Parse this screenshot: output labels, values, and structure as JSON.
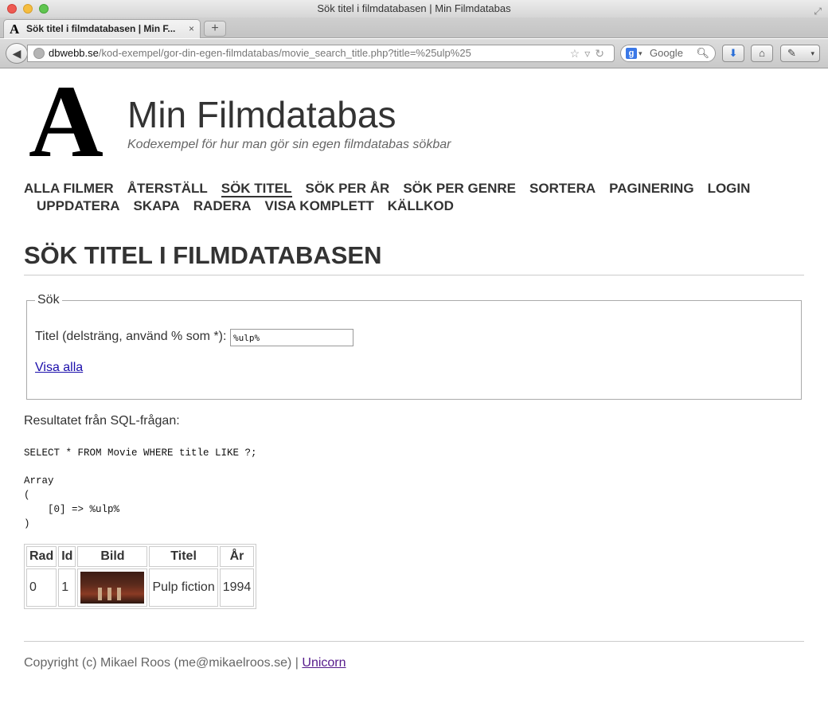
{
  "window": {
    "title": "Sök titel i filmdatabasen | Min Filmdatabas"
  },
  "tab": {
    "label": "Sök titel i filmdatabasen | Min F...",
    "favicon": "A",
    "new_tab": "+"
  },
  "address_bar": {
    "domain": "dbwebb.se",
    "path": "/kod-exempel/gor-din-egen-filmdatabas/movie_search_title.php?title=%25ulp%25",
    "search_engine": "Google"
  },
  "site": {
    "logo_letter": "A",
    "title": "Min Filmdatabas",
    "slogan": "Kodexempel för hur man gör sin egen filmdatabas sökbar"
  },
  "menu": {
    "row1": [
      "ALLA FILMER",
      "ÅTERSTÄLL",
      "SÖK TITEL",
      "SÖK PER ÅR",
      "SÖK PER GENRE",
      "SORTERA",
      "PAGINERING",
      "LOGIN"
    ],
    "row2": [
      "UPPDATERA",
      "SKAPA",
      "RADERA",
      "VISA KOMPLETT",
      "KÄLLKOD"
    ],
    "selected": "SÖK TITEL"
  },
  "page": {
    "heading": "SÖK TITEL I FILMDATABASEN",
    "fieldset_legend": "Sök",
    "title_label": "Titel (delsträng, använd % som *):",
    "title_value": "%ulp%",
    "show_all_link": "Visa alla",
    "result_label": "Resultatet från SQL-frågan:",
    "sql": "SELECT * FROM Movie WHERE title LIKE ?;",
    "array_dump": "Array\n(\n    [0] => %ulp%\n)"
  },
  "table": {
    "headers": [
      "Rad",
      "Id",
      "Bild",
      "Titel",
      "År"
    ],
    "rows": [
      {
        "rad": "0",
        "id": "1",
        "titel": "Pulp fiction",
        "ar": "1994"
      }
    ]
  },
  "footer": {
    "copyright": "Copyright (c) Mikael Roos (me@mikaelroos.se) |",
    "link": "Unicorn"
  }
}
